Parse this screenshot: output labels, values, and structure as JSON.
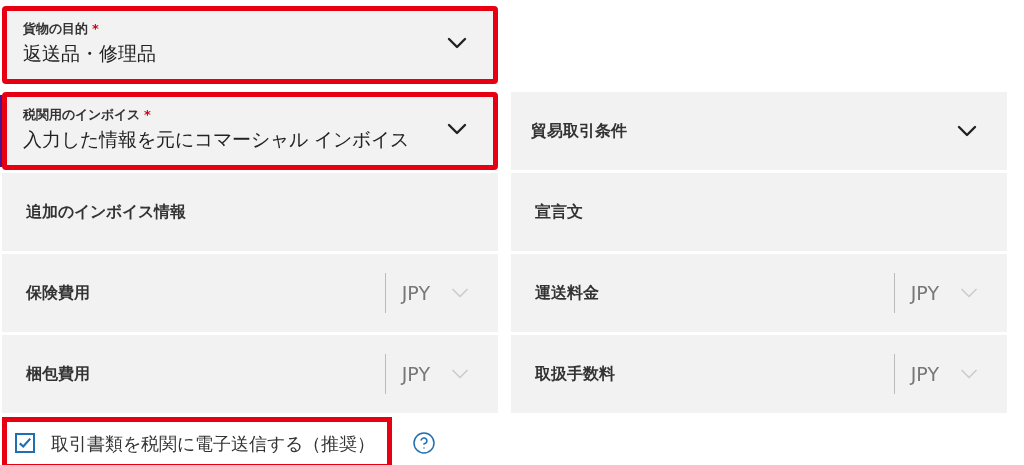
{
  "rows": [
    {
      "cells": [
        {
          "kind": "select",
          "label": "貨物の目的",
          "required_mark": "*",
          "value": "返送品・修理品",
          "highlighted": true,
          "focused": false
        }
      ]
    },
    {
      "cells": [
        {
          "kind": "select",
          "label": "税関用のインボイス",
          "required_mark": "*",
          "value": "入力した情報を元にコマーシャル インボイス",
          "highlighted": true,
          "focused": true
        },
        {
          "kind": "dropdown",
          "label": "貿易取引条件"
        }
      ]
    },
    {
      "cells": [
        {
          "kind": "section",
          "label": "追加のインボイス情報"
        },
        {
          "kind": "section",
          "label": "宣言文"
        }
      ]
    },
    {
      "cells": [
        {
          "kind": "amount",
          "label": "保険費用",
          "currency": "JPY"
        },
        {
          "kind": "amount",
          "label": "運送料金",
          "currency": "JPY"
        }
      ]
    },
    {
      "cells": [
        {
          "kind": "amount",
          "label": "梱包費用",
          "currency": "JPY"
        },
        {
          "kind": "amount",
          "label": "取扱手数料",
          "currency": "JPY"
        }
      ]
    }
  ],
  "e_submit": {
    "label": "取引書類を税関に電子送信する（推奨）",
    "checked": true,
    "highlighted": true
  }
}
